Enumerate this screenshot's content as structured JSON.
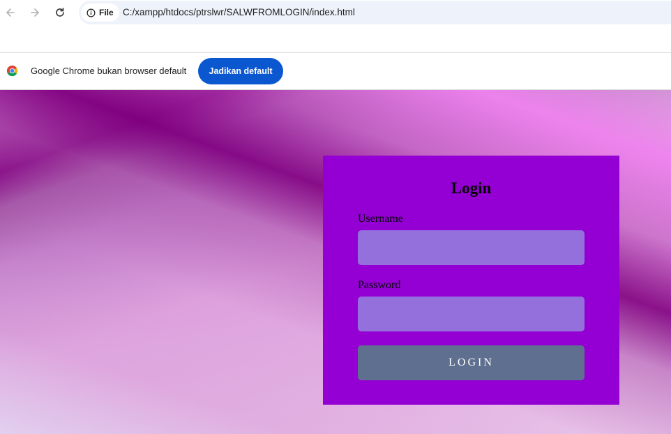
{
  "browser": {
    "url": "C:/xampp/htdocs/ptrslwr/SALWFROMLOGIN/index.html",
    "site_chip_label": "File",
    "icons": {
      "back": "back-arrow-icon",
      "forward": "forward-arrow-icon",
      "reload": "reload-icon",
      "site_info": "info-icon"
    }
  },
  "infobar": {
    "message": "Google Chrome bukan browser default",
    "button_label": "Jadikan default",
    "button_color": "#0b57d0",
    "icon": "chrome-logo-icon"
  },
  "page": {
    "background_colors": [
      "#800080",
      "#ee82ee",
      "#dda0dd"
    ],
    "login_form": {
      "title": "Login",
      "card_color": "#9400d3",
      "input_color": "#9370db",
      "button_color": "#5f6f8f",
      "username": {
        "label": "Username",
        "value": ""
      },
      "password": {
        "label": "Password",
        "value": ""
      },
      "submit_label": "LOGIN"
    }
  }
}
